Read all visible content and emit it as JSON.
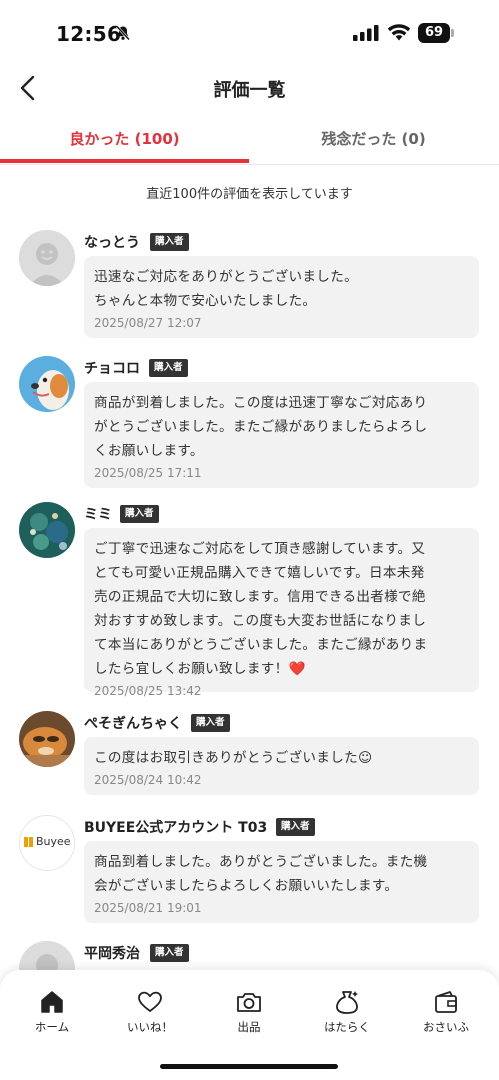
{
  "status_bar": {
    "time": "12:56",
    "battery": "69"
  },
  "header": {
    "title": "評価一覧"
  },
  "tabs": [
    {
      "label": "良かった (100)"
    },
    {
      "label": "残念だった (0)"
    }
  ],
  "notice": "直近100件の評価を表示しています",
  "reviews": [
    {
      "name": "なっとう",
      "badge": "購入者",
      "comment": "迅速なご対応をありがとうございました。\nちゃんと本物で安心いたしました。",
      "date": "2025/08/27 12:07"
    },
    {
      "name": "チョコロ",
      "badge": "購入者",
      "comment": "商品が到着しました。この度は迅速丁寧なご対応あり\nがとうございました。またご縁がありましたらよろし\nくお願いします。",
      "date": "2025/08/25 17:11"
    },
    {
      "name": "ミミ",
      "badge": "購入者",
      "comment": "ご丁寧で迅速なご対応をして頂き感謝しています。又\nとても可愛い正規品購入できて嬉しいです。日本未発\n売の正規品で大切に致します。信用できる出者様で絶\n対おすすめ致します。この度も大変お世話になりまし\nて本当にありがとうございました。またご縁がありま\nしたら宜しくお願い致します！❤️",
      "date": "2025/08/25 13:42"
    },
    {
      "name": "ぺそぎんちゃく",
      "badge": "購入者",
      "comment": "この度はお取引きありがとうございました☺",
      "date": "2025/08/24 10:42"
    },
    {
      "name": "BUYEE公式アカウント T03",
      "badge": "購入者",
      "comment": "商品到着しました。ありがとうございました。また機\n会がございましたらよろしくお願いいたします。",
      "date": "2025/08/21 19:01",
      "avatar_text": "Buyee"
    },
    {
      "name": "平岡秀治",
      "badge": "購入者"
    }
  ],
  "bottom_nav": [
    {
      "label": "ホーム",
      "icon": "home-icon"
    },
    {
      "label": "いいね！",
      "icon": "heart-icon"
    },
    {
      "label": "出品",
      "icon": "camera-icon"
    },
    {
      "label": "はたらく",
      "icon": "money-bag-icon"
    },
    {
      "label": "おさいふ",
      "icon": "wallet-icon"
    }
  ],
  "colors": {
    "accent": "#e8303a",
    "bubble": "#f2f2f2"
  }
}
